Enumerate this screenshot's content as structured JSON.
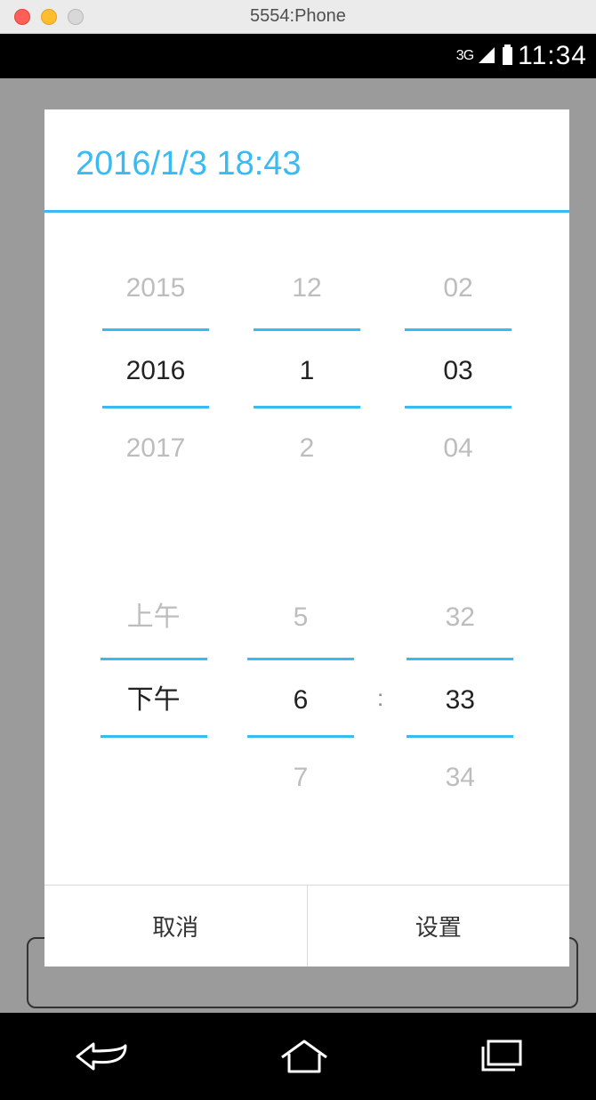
{
  "window_title": "5554:Phone",
  "status": {
    "network_label": "3G",
    "clock": "11:34"
  },
  "dialog": {
    "title": "2016/1/3 18:43",
    "date_picker": {
      "year": {
        "prev": "2015",
        "selected": "2016",
        "next": "2017"
      },
      "month": {
        "prev": "12",
        "selected": "1",
        "next": "2"
      },
      "day": {
        "prev": "02",
        "selected": "03",
        "next": "04"
      }
    },
    "time_picker": {
      "ampm": {
        "prev": "上午",
        "selected": "下午",
        "next": ""
      },
      "hour": {
        "prev": "5",
        "selected": "6",
        "next": "7"
      },
      "separator": ":",
      "minute": {
        "prev": "32",
        "selected": "33",
        "next": "34"
      }
    },
    "buttons": {
      "cancel": "取消",
      "confirm": "设置"
    }
  }
}
